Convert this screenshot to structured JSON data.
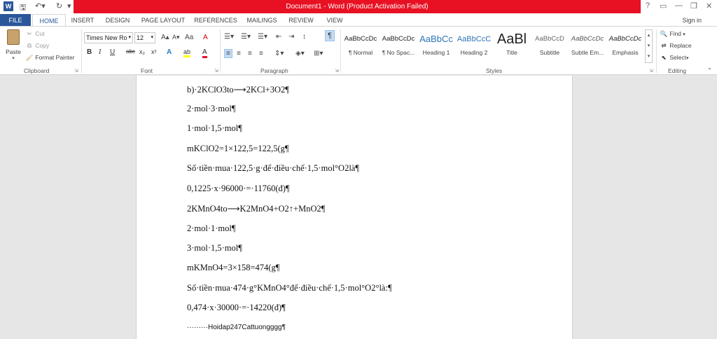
{
  "titlebar": {
    "title": "Document1 - Word (Product Activation Failed)",
    "logo": "W",
    "qat_icons": [
      "save-icon",
      "undo-icon",
      "redo-icon",
      "customize-icon"
    ],
    "help": "?",
    "ribbon_display": "▭",
    "minimize": "—",
    "restore": "❐",
    "close": "✕"
  },
  "tabs": [
    "FILE",
    "HOME",
    "INSERT",
    "DESIGN",
    "PAGE LAYOUT",
    "REFERENCES",
    "MAILINGS",
    "REVIEW",
    "VIEW"
  ],
  "signin": "Sign in",
  "clipboard": {
    "paste": "Paste",
    "cut": "Cut",
    "copy": "Copy",
    "format_painter": "Format Painter",
    "label": "Clipboard"
  },
  "font": {
    "name": "Times New Ro",
    "size": "12",
    "grow": "A▴",
    "shrink": "A▾",
    "case": "Aa",
    "clear": "A",
    "bold": "B",
    "italic": "I",
    "underline": "U",
    "strike": "abc",
    "subscript": "x₂",
    "superscript": "x²",
    "effects": "A",
    "highlight": "ab",
    "color": "A",
    "label": "Font"
  },
  "paragraph": {
    "label": "Paragraph"
  },
  "styles": {
    "items": [
      {
        "preview": "AaBbCcDc",
        "name": "¶ Normal"
      },
      {
        "preview": "AaBbCcDc",
        "name": "¶ No Spac..."
      },
      {
        "preview": "AaBbCc",
        "name": "Heading 1"
      },
      {
        "preview": "AaBbCcC",
        "name": "Heading 2"
      },
      {
        "preview": "AaBl",
        "name": "Title"
      },
      {
        "preview": "AaBbCcD",
        "name": "Subtitle"
      },
      {
        "preview": "AaBbCcDc",
        "name": "Subtle Em..."
      },
      {
        "preview": "AaBbCcDc",
        "name": "Emphasis"
      }
    ],
    "label": "Styles"
  },
  "editing": {
    "find": "Find",
    "replace": "Replace",
    "select": "Select",
    "label": "Editing"
  },
  "document": {
    "lines": [
      "b)·2KClO3to⟶2KCl+3O2¶",
      "2·mol·3·mol¶",
      "1·mol·1,5·mol¶",
      "mKClO2=1×122,5=122,5(g¶",
      "Số·tiền·mua·122,5·g·để·điều·chế·1,5·mol°O2là¶",
      "0,1225·x·96000·=·11760(đ)¶",
      "2KMnO4to⟶K2MnO4+O2↑+MnO2¶",
      "2·mol·1·mol¶",
      "3·mol·1,5·mol¶",
      "mKMnO4=3×158=474(g¶",
      "Số·tiền·mua·474·g°KMnO4°để·điều·chế·1,5·mol°O2°là:¶",
      "0,474·x·30000·=·14220(đ)¶",
      "·········Hoidap247Cattuongggg¶"
    ]
  },
  "colors": {
    "accent": "#2b579a",
    "title_bar_error": "#e81123"
  }
}
